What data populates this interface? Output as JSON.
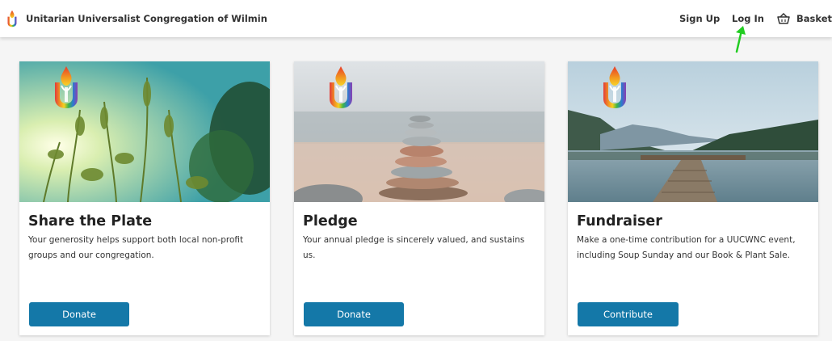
{
  "header": {
    "org_name": "Unitarian Universalist Congregation of Wilmin",
    "nav": {
      "sign_up": "Sign Up",
      "log_in": "Log In",
      "basket": "Basket"
    }
  },
  "cards": [
    {
      "title": "Share the Plate",
      "description": "Your generosity helps support both local non-profit groups and our congregation.",
      "button": "Donate"
    },
    {
      "title": "Pledge",
      "description": "Your annual pledge is sincerely valued, and sustains us.",
      "button": "Donate"
    },
    {
      "title": "Fundraiser",
      "description": "Make a one-time contribution for a UUCWNC event, including Soup Sunday and our Book & Plant Sale.",
      "button": "Contribute"
    }
  ],
  "colors": {
    "button": "#1478a8",
    "cursor": "#22cc22"
  }
}
